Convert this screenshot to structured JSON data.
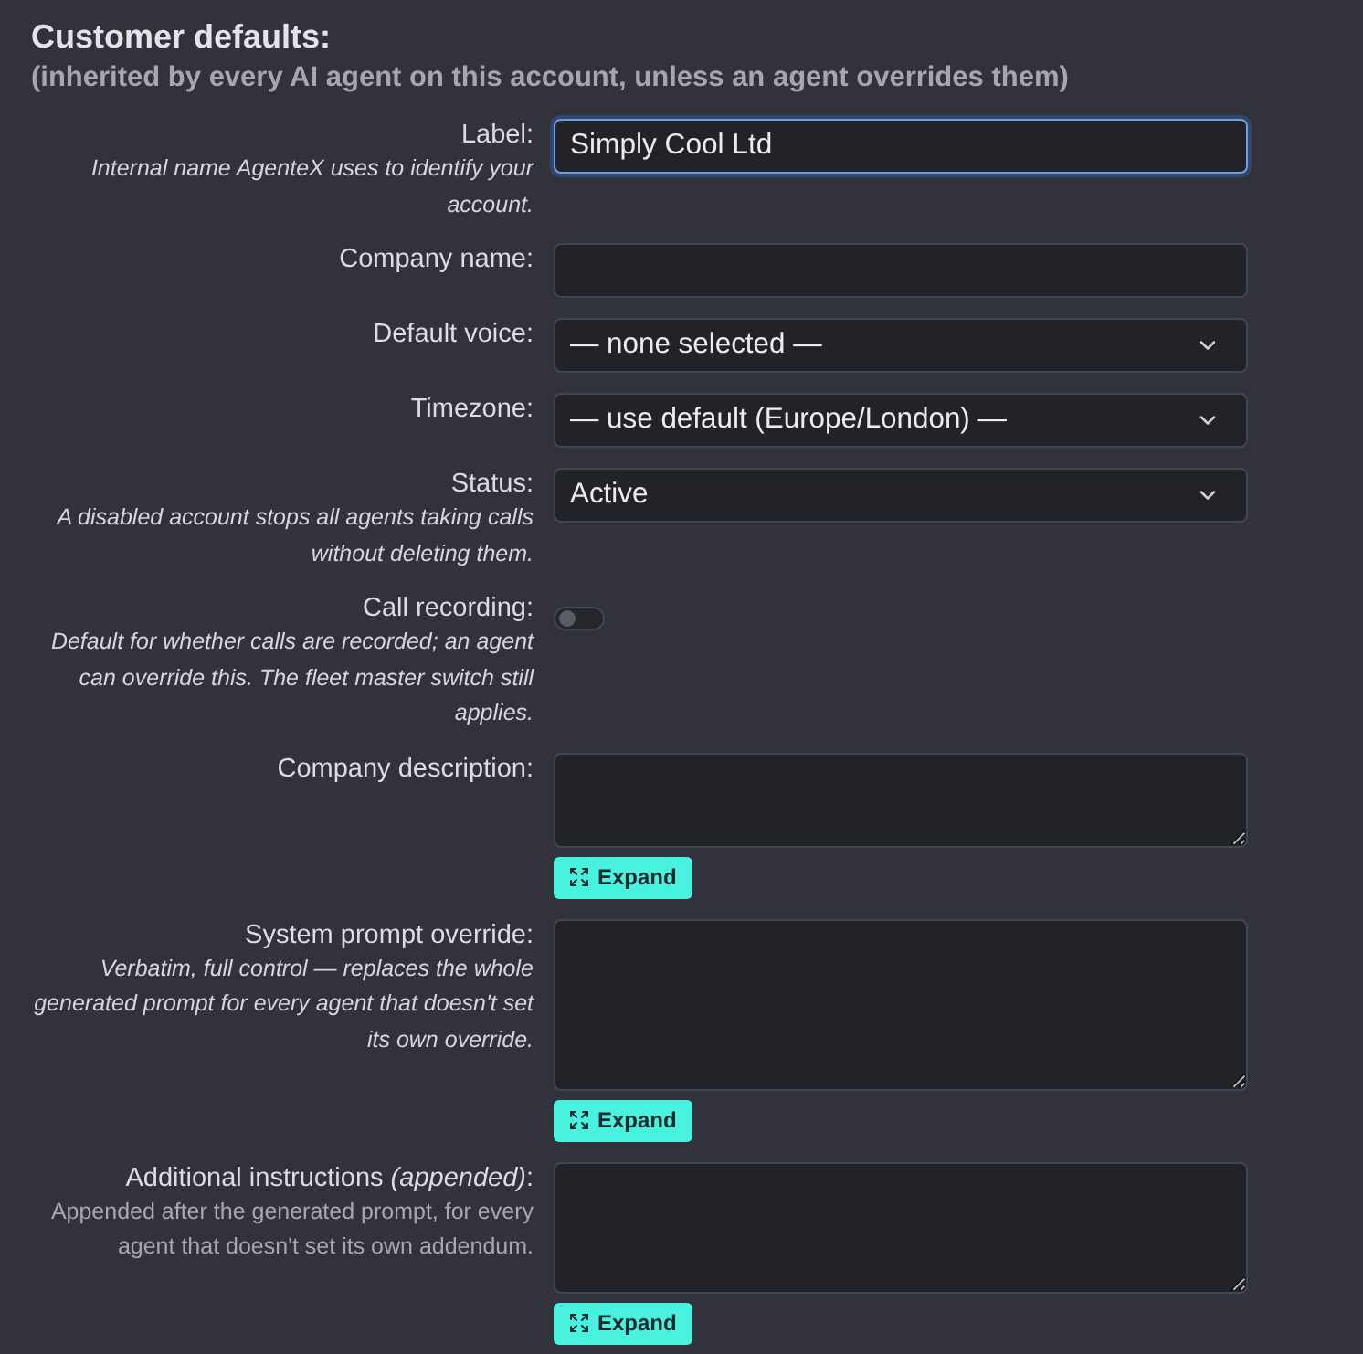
{
  "title": "Customer defaults:",
  "subtitle": "(inherited by every AI agent on this account, unless an agent overrides them)",
  "fields": [
    {
      "kind": "text",
      "label": "Label:",
      "hint": "Internal name AgenteX uses to identify your account.",
      "italic": true,
      "value": "Simply Cool Ltd",
      "focused": true
    },
    {
      "kind": "text",
      "label": "Company name:",
      "focused": false
    },
    {
      "kind": "select",
      "label": "Default voice:",
      "value": "— none selected —"
    },
    {
      "kind": "select",
      "label": "Timezone:",
      "value": "— use default (Europe/London) —"
    },
    {
      "kind": "select",
      "label": "Status:",
      "hint": "A disabled account stops all agents taking calls without deleting them.",
      "italic": true,
      "value": "Active"
    },
    {
      "kind": "toggle",
      "label": "Call recording:",
      "hint": "Default for whether calls are recorded; an agent can override this. The fleet master switch still applies.",
      "italic": true,
      "on": false
    },
    {
      "kind": "textarea",
      "label": "Company description:",
      "button": "Expand"
    },
    {
      "kind": "textarea",
      "label": "System prompt override:",
      "hint": "Verbatim, full control — replaces the whole generated prompt for every agent that doesn't set its own override.",
      "italic": true,
      "button": "Expand"
    },
    {
      "kind": "textarea",
      "label": "Additional instructions *(appended)*:",
      "hint": "Appended after the generated prompt, for every agent that doesn't set its own addendum.",
      "italic": false,
      "button": "Expand"
    }
  ]
}
